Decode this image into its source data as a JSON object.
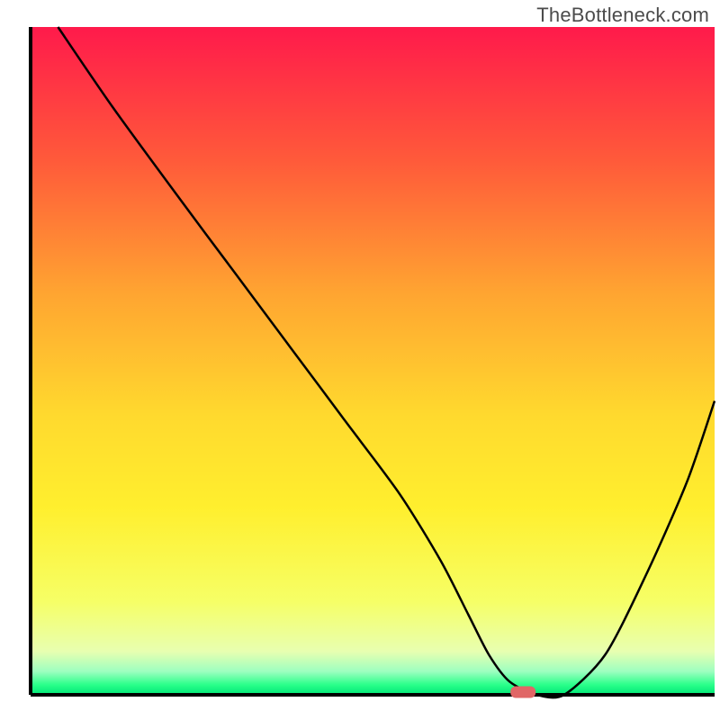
{
  "watermark": "TheBottleneck.com",
  "chart_data": {
    "type": "line",
    "title": "",
    "xlabel": "",
    "ylabel": "",
    "xlim": [
      0,
      100
    ],
    "ylim": [
      0,
      100
    ],
    "grid": false,
    "legend": false,
    "series": [
      {
        "name": "bottleneck-curve",
        "x": [
          4,
          12,
          22,
          30,
          38,
          46,
          54,
          60,
          64,
          67,
          70,
          74,
          78,
          84,
          90,
          96,
          100
        ],
        "y": [
          100,
          88,
          74,
          63,
          52,
          41,
          30,
          20,
          12,
          6,
          2,
          0,
          0,
          6,
          18,
          32,
          44
        ]
      }
    ],
    "marker": {
      "name": "optimal-point",
      "x": 72,
      "y": 0,
      "color": "#e06666",
      "shape": "pill"
    },
    "gradient_bands": [
      {
        "stop": 0.0,
        "color": "#ff1a4b"
      },
      {
        "stop": 0.2,
        "color": "#ff5a3a"
      },
      {
        "stop": 0.4,
        "color": "#ffa531"
      },
      {
        "stop": 0.58,
        "color": "#ffd92e"
      },
      {
        "stop": 0.72,
        "color": "#ffef2e"
      },
      {
        "stop": 0.86,
        "color": "#f6ff66"
      },
      {
        "stop": 0.935,
        "color": "#e8ffb0"
      },
      {
        "stop": 0.965,
        "color": "#9dffc0"
      },
      {
        "stop": 0.985,
        "color": "#2aff8a"
      },
      {
        "stop": 1.0,
        "color": "#00e676"
      }
    ],
    "axes_color": "#000000"
  }
}
